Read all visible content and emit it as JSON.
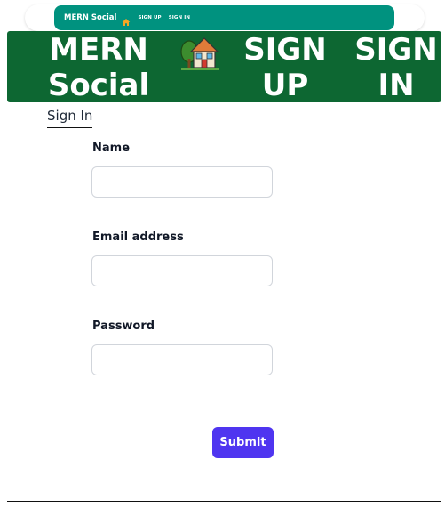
{
  "topbar": {
    "brand": "MERN Social",
    "home_icon": "home-icon",
    "links": [
      "SIGN UP",
      "SIGN IN"
    ],
    "accent_color": "#00927f"
  },
  "navbar": {
    "brand_line1": "MERN",
    "brand_line2": "Social",
    "home_icon": "house-with-garden-icon",
    "signup_line1": "SIGN",
    "signup_line2": "UP",
    "signin_line1": "SIGN",
    "signin_line2": "IN",
    "background_color": "#0d6732"
  },
  "tab": {
    "label": "Sign In"
  },
  "form": {
    "name_label": "Name",
    "name_value": "",
    "email_label": "Email address",
    "email_value": "",
    "password_label": "Password",
    "password_value": "",
    "submit_label": "Submit",
    "submit_color": "#4f35f0"
  }
}
